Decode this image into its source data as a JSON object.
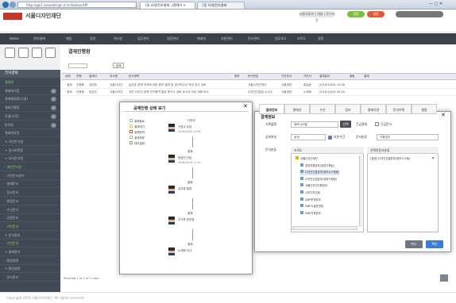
{
  "browser": {
    "address": "http://gw1.seouldesign.or.kr/bizbox/HP",
    "tabs": [
      {
        "label": "[정 카세]전자결재 그룹웨어 ×",
        "active": true
      },
      {
        "label": "[정 카세]전자결재",
        "active": false
      }
    ]
  },
  "header": {
    "app_title": "서울디자인재단",
    "user_pills": [
      "사용자정보 | 개설 | 로그아웃",
      "알림",
      "설정"
    ],
    "pill_colors": [
      "#e8e8e8",
      "#7bbf3e",
      "#e05a3a"
    ]
  },
  "gnb": {
    "items": [
      "Home",
      "전자결재",
      "메일",
      "일정",
      "게시판",
      "업무관리",
      "일정관리",
      "메세지",
      "자원관리",
      "문서관리",
      "업무보고",
      "조직도",
      "설정"
    ]
  },
  "sidebar": {
    "section_title": "전자결재",
    "items": [
      {
        "label": "결재함",
        "green": true,
        "badge": ""
      },
      {
        "label": "결재대기함",
        "green": false,
        "badge": "0"
      },
      {
        "label": "결재예정함(기결)",
        "green": false,
        "badge": "0"
      },
      {
        "label": "결재진행함",
        "green": false,
        "badge": "0"
      },
      {
        "label": "후결(사후)",
        "green": false,
        "badge": "0"
      },
      {
        "label": "반려함",
        "green": false,
        "badge": "3"
      },
      {
        "label": "결재완료함",
        "green": false,
        "badge": ""
      },
      {
        "label": "+ 기안문서함",
        "green": false,
        "badge": ""
      },
      {
        "label": "+ 임시보관함",
        "green": false,
        "badge": ""
      },
      {
        "label": "+ 부서문서함",
        "green": false,
        "badge": ""
      },
      {
        "label": "- 개인문서함",
        "green": true,
        "badge": ""
      },
      {
        "label": "· 기안문서관리",
        "green": false,
        "badge": ""
      },
      {
        "label": "· 결재문서",
        "green": false,
        "badge": ""
      },
      {
        "label": "· 참조문서",
        "green": false,
        "badge": ""
      },
      {
        "label": "· 회람문서",
        "green": false,
        "badge": ""
      },
      {
        "label": "· 수신문서",
        "green": false,
        "badge": ""
      },
      {
        "label": "· 공람문서",
        "green": false,
        "badge": ""
      },
      {
        "label": "· 기안문서",
        "green": true,
        "badge": ""
      },
      {
        "label": "+ 문서관리",
        "green": false,
        "badge": ""
      },
      {
        "label": "· 기안문서",
        "green": true,
        "badge": ""
      },
      {
        "label": "+ 결재관리",
        "green": false,
        "badge": ""
      },
      {
        "label": "· 환경설정",
        "green": false,
        "badge": ""
      },
      {
        "label": "+ 환경설정",
        "green": false,
        "badge": ""
      },
      {
        "label": "· 양식관리",
        "green": false,
        "badge": ""
      }
    ]
  },
  "main": {
    "page_title": "결재진행함",
    "search_label": "검색",
    "table_headers": [
      "상태",
      "진행",
      "결재자",
      "부서명",
      "문서제목",
      "첨부",
      "문서번호",
      "기안부서",
      "기안자",
      "결재일자",
      "열람",
      "결재"
    ],
    "rows": [
      {
        "status": "결재",
        "progress": "진행중",
        "approver": "김미정",
        "dept": "서울디자인",
        "title": "늘푸른 정책 자격에 대한 용역 결과 및 정산보고서 작성 업무 검토",
        "doc_no": "서울디자인재단-",
        "from_dept": "서울경영",
        "drafter": "홍길동",
        "date": "2016/10/04 10:56"
      },
      {
        "status": "결재",
        "progress": "진행중",
        "approver": "정성민",
        "dept": "서울디자인",
        "title": "국민 디자인 정책 연구용역 결과 평가서 검토 보고서 작성 계획 보고",
        "doc_no": "디자인진흥팀-1023",
        "from_dept": "서울경영",
        "drafter": "노재희",
        "date": "2016/10/04 09:20"
      }
    ],
    "pager": "Showing 1 to 2 of 2 rows"
  },
  "modal_status": {
    "title": "공재진행 상태 보기",
    "legend": [
      "결재완료",
      "결재대기",
      "결재반려",
      "결재보류",
      "대리결재"
    ],
    "people": [
      {
        "role": "기안자",
        "name": "구본수 주임",
        "date": "2016/10/04 10:56"
      },
      {
        "role": "결재",
        "name": "정성민 선임",
        "date": "2016/10/04 11:10"
      },
      {
        "role": "결재",
        "name": "김지훈 팀장",
        "date": ""
      },
      {
        "role": "결재",
        "name": "이기준 본부장",
        "date": ""
      },
      {
        "role": "결재",
        "name": "노재희 이사",
        "date": ""
      }
    ]
  },
  "modal_info": {
    "title": "결재정보",
    "tabs": [
      "결재정보",
      "결재선",
      "수신",
      "참조",
      "결재의견",
      "문서이력",
      "열람"
    ],
    "fields": {
      "doc_kind_label": "기록물철",
      "doc_kind_value": "정보시스템",
      "select_label": "선택",
      "public_label": "공개여부",
      "public_value": "공개",
      "retention_label": "보존기간",
      "retention_value": "5년",
      "dept_label": "기안부서",
      "dept_value": "서울디자인재단",
      "urgent_label": "긴급결재",
      "urgent_check": "긴급문서",
      "pages_label": "문서분류",
      "category_label": "문서분류",
      "category_value": "기획업무"
    },
    "tree_header": "조직도",
    "tree_items": [
      "서울디자인재단",
      "경영지원본부(경영기획팀)",
      "디자인진흥본부(정보시스템팀)",
      "디자인산업본부(경영기획팀)",
      "서울디자인지원센터",
      "시민디자인팀",
      "DDP운영본부",
      "DDP시설운영팀",
      "DDP기획본부"
    ],
    "selected_header": "선택된문서분류",
    "selected_item": "[경영] 디자인진흥본부(정보시스템)",
    "ok": "확인",
    "cancel": "취소"
  },
  "footer": {
    "text": "Copyright 2016 서울디자인재단. All rights reserved."
  },
  "colors": {
    "brand": "#c0392b",
    "sidebar": "#414955",
    "gnb": "#3a414a",
    "ok_button": "#3a7bd5",
    "cancel_button": "#6b7784"
  }
}
